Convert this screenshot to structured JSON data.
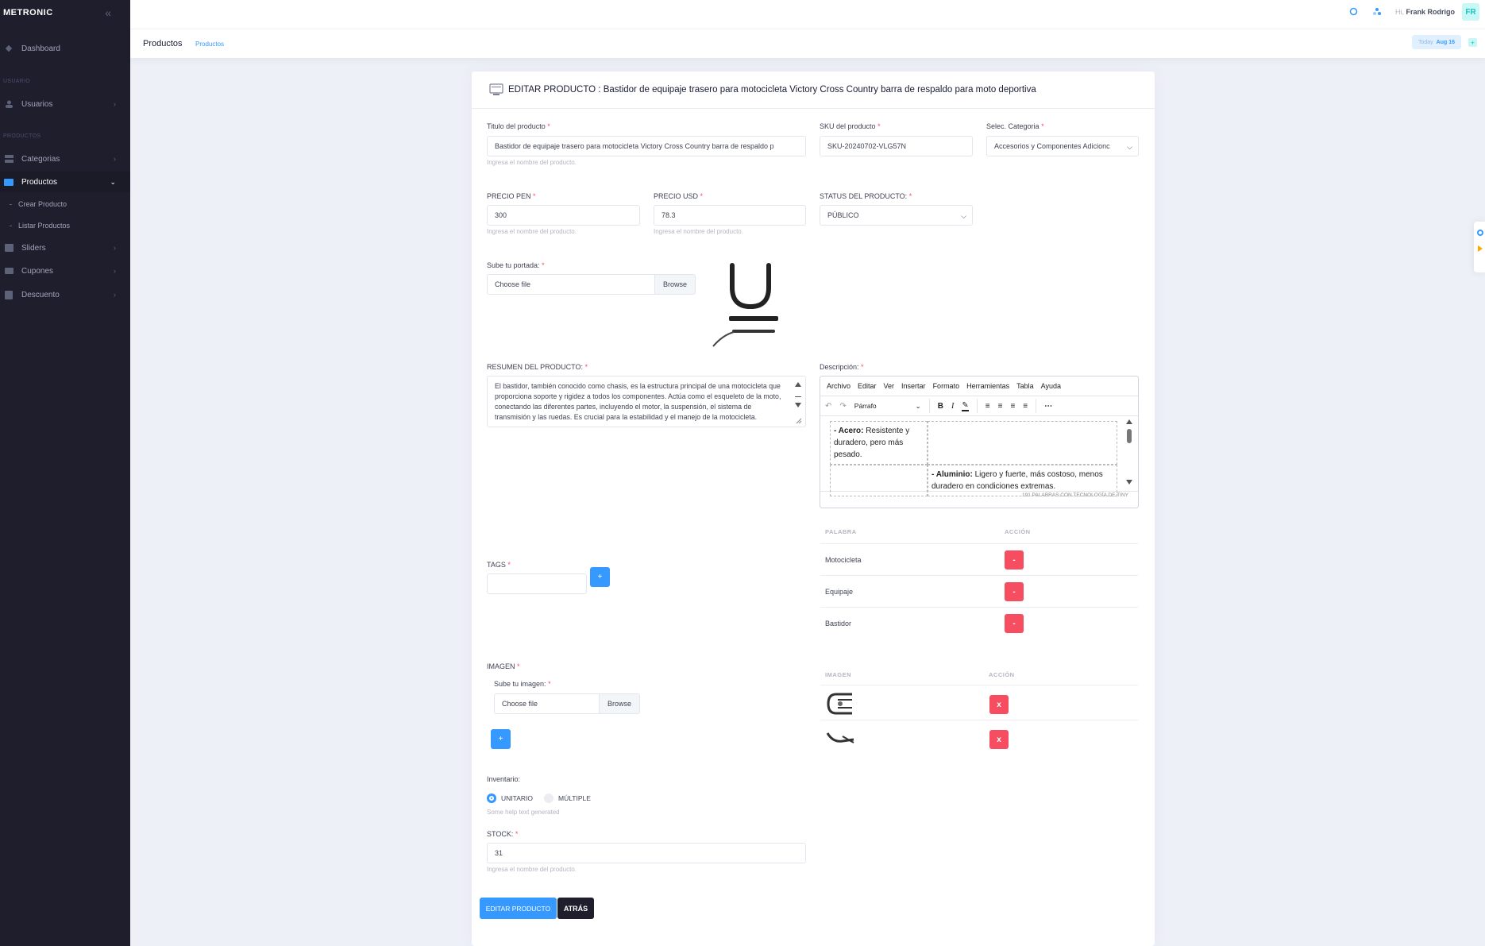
{
  "brand": "METRONIC",
  "sidebar": {
    "dashboard": "Dashboard",
    "section_usuario": "USUARIO",
    "usuarios": "Usuarios",
    "section_productos": "PRODUCTOS",
    "categorias": "Categorias",
    "productos": "Productos",
    "crear_producto": "Crear Producto",
    "listar_productos": "Listar Productos",
    "sliders": "Sliders",
    "cupones": "Cupones",
    "descuento": "Descuento"
  },
  "topbar": {
    "greeting": "Hi,",
    "user_name": "Frank Rodrigo",
    "avatar_initials": "FR"
  },
  "subheader": {
    "title": "Productos",
    "breadcrumb": "Productos",
    "today_label": "Today",
    "today_date": "Aug 16"
  },
  "form": {
    "card_title": "EDITAR PRODUCTO : Bastidor de equipaje trasero para motocicleta Victory Cross Country barra de respaldo para moto deportiva",
    "titulo_label": "Titulo del producto",
    "titulo_value": "Bastidor de equipaje trasero para motocicleta Victory Cross Country barra de respaldo p",
    "titulo_help": "Ingresa el nombre del producto.",
    "sku_label": "SKU del producto",
    "sku_value": "SKU-20240702-VLG57N",
    "categoria_label": "Selec. Categoria",
    "categoria_value": "Accesorios y Componentes Adicionc",
    "precio_pen_label": "PRECIO PEN",
    "precio_pen_value": "300",
    "precio_pen_help": "Ingresa el nombre del producto.",
    "precio_usd_label": "PRECIO USD",
    "precio_usd_value": "78.3",
    "precio_usd_help": "Ingresa el nombre del producto.",
    "status_label": "STATUS DEL PRODUCTO:",
    "status_value": "PÚBLICO",
    "portada_label": "Sube tu portada:",
    "choose_file": "Choose file",
    "browse": "Browse",
    "resumen_label": "RESUMEN DEL PRODUCTO:",
    "resumen_value": "El bastidor, también conocido como chasis, es la estructura principal de una motocicleta que proporciona soporte y rigidez a todos los componentes. Actúa como el esqueleto de la moto, conectando las diferentes partes, incluyendo el motor, la suspensión, el sistema de transmisión y las ruedas. Es crucial para la estabilidad y el manejo de la motocicleta.",
    "descripcion_label": "Descripción:",
    "tags_label": "TAGS",
    "imagen_label": "IMAGEN",
    "sube_imagen_label": "Sube tu imagen:",
    "inventario_label": "Inventario:",
    "unitario": "UNITARIO",
    "multiple": "MÚLTIPLE",
    "inventario_help": "Some help text generated",
    "stock_label": "STOCK:",
    "stock_value": "31",
    "stock_help": "Ingresa el nombre del producto.",
    "submit": "EDITAR PRODUCTO",
    "back": "ATRÁS",
    "add": "+",
    "req": "*"
  },
  "editor": {
    "menu": [
      "Archivo",
      "Editar",
      "Ver",
      "Insertar",
      "Formato",
      "Herramientas",
      "Tabla",
      "Ayuda"
    ],
    "block_format": "Párrafo",
    "cell1_bold": "- Acero:",
    "cell1_text": " Resistente y duradero, pero más pesado.",
    "cell2_bold": "- Aluminio:",
    "cell2_text": " Ligero y fuerte, más costoso, menos duradero en condiciones extremas.",
    "status": "191 PALABRAS  CON TECNOLOGÍA DE TINY"
  },
  "tags_table": {
    "headers": [
      "PALABRA",
      "ACCIÓN"
    ],
    "rows": [
      "Motocicleta",
      "Equipaje",
      "Bastidor"
    ],
    "remove_label": "-"
  },
  "images_table": {
    "headers": [
      "IMAGEN",
      "ACCIÓN"
    ],
    "remove_label": "x",
    "count": 2
  },
  "colors": {
    "primary": "#3699ff",
    "danger": "#f64e60",
    "sidebar_bg": "#1e1e2d"
  }
}
